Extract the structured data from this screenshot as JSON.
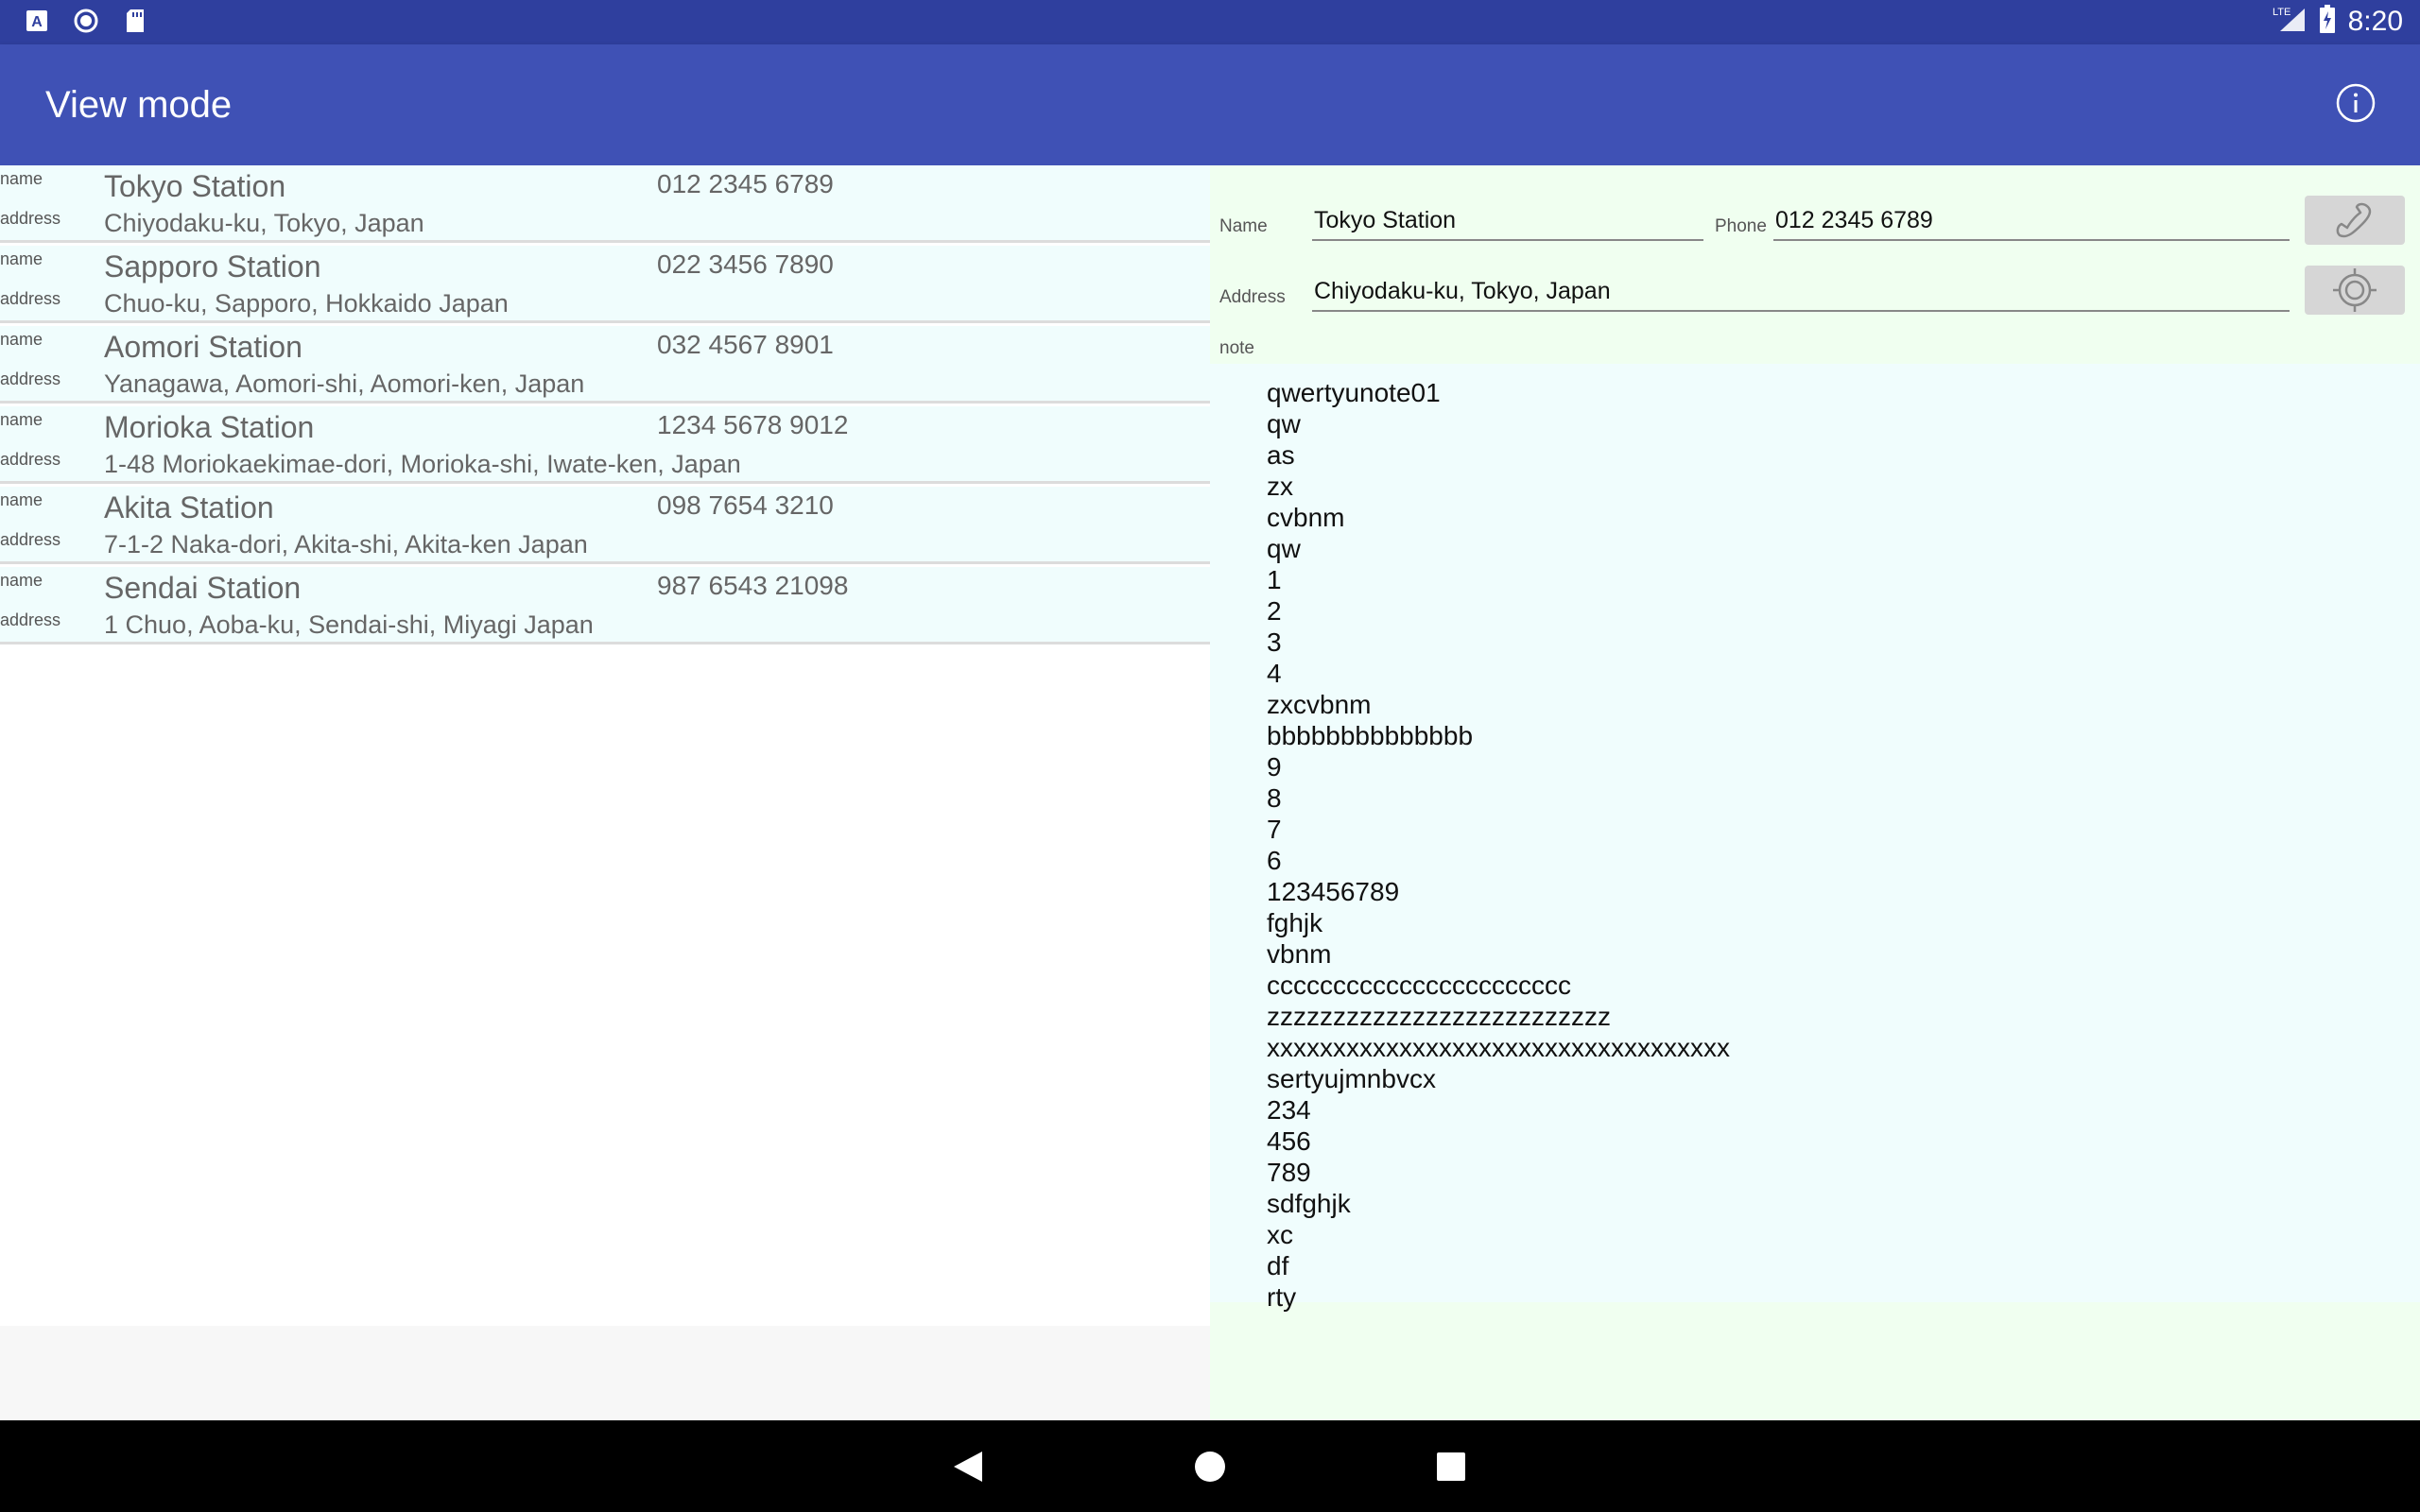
{
  "status_bar": {
    "time": "8:20",
    "network": "LTE",
    "icons": [
      "a-box-icon",
      "circle-icon",
      "sd-card-icon",
      "signal-icon",
      "battery-charging-icon"
    ]
  },
  "app_bar": {
    "title": "View mode",
    "info_icon": "info-icon"
  },
  "list": {
    "name_label": "name",
    "address_label": "address",
    "items": [
      {
        "name": "Tokyo Station",
        "phone": "012 2345 6789",
        "address": "Chiyodaku-ku, Tokyo, Japan"
      },
      {
        "name": "Sapporo Station",
        "phone": "022 3456 7890",
        "address": "Chuo-ku, Sapporo, Hokkaido Japan"
      },
      {
        "name": "Aomori Station",
        "phone": "032 4567 8901",
        "address": "Yanagawa, Aomori-shi, Aomori-ken, Japan"
      },
      {
        "name": "Morioka Station",
        "phone": "1234 5678 9012",
        "address": "1-48 Moriokaekimae-dori, Morioka-shi, Iwate-ken, Japan"
      },
      {
        "name": "Akita Station",
        "phone": "098 7654 3210",
        "address": "7-1-2 Naka-dori, Akita-shi, Akita-ken Japan"
      },
      {
        "name": "Sendai Station",
        "phone": "987 6543 21098",
        "address": "1 Chuo, Aoba-ku, Sendai-shi, Miyagi Japan"
      }
    ]
  },
  "detail": {
    "name_label": "Name",
    "name_value": "Tokyo Station",
    "phone_label": "Phone",
    "phone_value": "012 2345 6789",
    "address_label": "Address",
    "address_value": "Chiyodaku-ku, Tokyo, Japan",
    "note_label": "note",
    "call_icon": "phone-handset-icon",
    "locate_icon": "crosshair-icon",
    "note": "qwertyunote01\nqw\nas\nzx\ncvbnm\nqw\n1\n2\n3\n4\nzxcvbnm\nbbbbbbbbbbbbbb\n9\n8\n7\n6\n123456789\nfghjk\nvbnm\nccccccccccccccccccccccc\nzzzzzzzzzzzzzzzzzzzzzzzzzz\nxxxxxxxxxxxxxxxxxxxxxxxxxxxxxxxxxxx\nsertyujmnbvcx\n234\n456\n789\nsdfghjk\nxc\ndf\nrty"
  },
  "nav_bar": {
    "buttons": [
      "back-icon",
      "home-icon",
      "recents-icon"
    ]
  },
  "colors": {
    "status_bar": "#2f3f9e",
    "app_bar": "#3f51b5",
    "list_row_bg": "#f0fdfd",
    "detail_bg": "#f0fff0"
  }
}
